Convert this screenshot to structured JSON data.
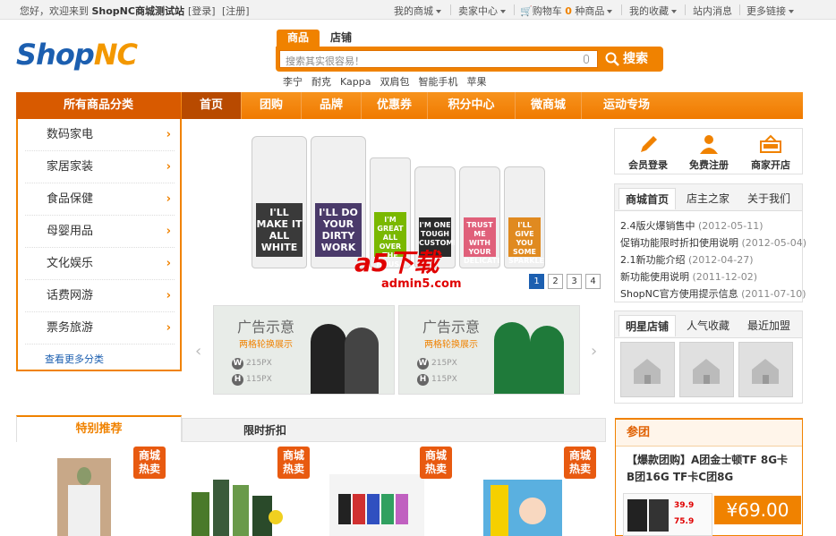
{
  "topbar": {
    "welcome": "您好，欢迎来到",
    "site_name": "ShopNC商城测试站",
    "login": "[登录]",
    "register": "[注册]",
    "my_mall": "我的商城",
    "seller_center": "卖家中心",
    "cart_label": "购物车",
    "cart_count": "0",
    "cart_unit": "种商品",
    "favorites": "我的收藏",
    "messages": "站内消息",
    "more_links": "更多链接"
  },
  "logo": {
    "shop": "Shop",
    "nc": "NC"
  },
  "search": {
    "tab_goods": "商品",
    "tab_store": "店铺",
    "placeholder": "搜索其实很容易！",
    "button": "搜索",
    "keywords": [
      "李宁",
      "耐克",
      "Kappa",
      "双肩包",
      "智能手机",
      "苹果"
    ]
  },
  "nav": {
    "category_header": "所有商品分类",
    "items": [
      "首页",
      "团购",
      "品牌",
      "优惠券",
      "积分中心",
      "微商城",
      "运动专场"
    ]
  },
  "categories": [
    "数码家电",
    "家居家装",
    "食品保健",
    "母婴用品",
    "文化娱乐",
    "话费网游",
    "票务旅游"
  ],
  "more_categories": "查看更多分类",
  "banner": {
    "bottles": [
      "I'LL MAKE IT ALL WHITE",
      "I'LL DO YOUR DIRTY WORK",
      "I'M GREAT ALL OVER THE HOUSE",
      "I'M ONE TOUGH CUSTOMER",
      "TRUST ME WITH YOUR DELICATES",
      "I'LL GIVE YOU SOME SPARKLE"
    ],
    "pages": [
      "1",
      "2",
      "3",
      "4"
    ],
    "active_page": "1",
    "watermark_a5": "a5下载",
    "watermark_url": "admin5.com"
  },
  "ads": [
    {
      "title": "广告示意",
      "subtitle": "两格轮换展示",
      "w": "215PX",
      "h": "115PX"
    },
    {
      "title": "广告示意",
      "subtitle": "两格轮换展示",
      "w": "215PX",
      "h": "115PX"
    }
  ],
  "member": {
    "login": "会员登录",
    "register": "免费注册",
    "open_shop": "商家开店"
  },
  "news_tabs": [
    "商城首页",
    "店主之家",
    "关于我们"
  ],
  "news": [
    {
      "title": "2.4版火爆销售中",
      "date": "(2012-05-11)"
    },
    {
      "title": "促销功能限时折扣使用说明",
      "date": "(2012-05-04)"
    },
    {
      "title": "2.1新功能介绍",
      "date": "(2012-04-27)"
    },
    {
      "title": "新功能使用说明",
      "date": "(2011-12-02)"
    },
    {
      "title": "ShopNC官方使用提示信息",
      "date": "(2011-07-10)"
    }
  ],
  "shop_tabs": [
    "明星店铺",
    "人气收藏",
    "最近加盟"
  ],
  "recommend": {
    "tab_featured": "特别推荐",
    "tab_limited": "限时折扣",
    "hot_label_1": "商城",
    "hot_label_2": "热卖"
  },
  "group": {
    "header": "参团",
    "title": "【爆款团购】A团金士顿TF 8G卡 B团16G TF卡C团8G",
    "price": "¥69.00",
    "tag1": "39.9",
    "tag2": "75.9"
  },
  "colors": {
    "accent": "#f08200",
    "brand_blue": "#1c5fb0",
    "nav_active": "#b84a00"
  }
}
